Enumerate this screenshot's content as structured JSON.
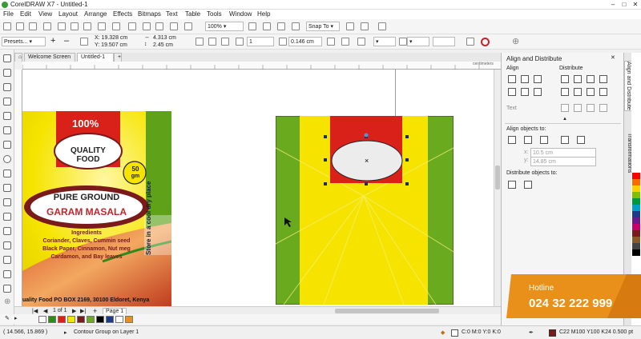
{
  "window": {
    "title": "CorelDRAW X7 - Untitled-1"
  },
  "menu": [
    "File",
    "Edit",
    "View",
    "Layout",
    "Arrange",
    "Effects",
    "Bitmaps",
    "Text",
    "Table",
    "Tools",
    "Window",
    "Help"
  ],
  "toolbar": {
    "zoom": "100%",
    "snap_label": "Snap To"
  },
  "propbar": {
    "presets": "Presets...",
    "x": "X: 19.328 cm",
    "y": "Y: 19.507 cm",
    "w": "4.313 cm",
    "h": "2.45 cm",
    "steps": "1",
    "offset": "0.146 cm"
  },
  "tabs": {
    "welcome": "Welcome Screen",
    "doc": "Untitled-1"
  },
  "ruler_unit": "centimeters",
  "pager": {
    "current": "1 of 1",
    "page": "Page 1"
  },
  "package": {
    "percent": "100%",
    "brand": "QUALITY FOOD",
    "weight_num": "50",
    "weight_unit": "gm",
    "side_text": "Store in a cool dry place",
    "product_line1": "PURE GROUND",
    "product_line2": "GARAM MASALA",
    "ingredients_title": "Ingredients",
    "ingredients_lines": [
      "Coriander, Claves, Cummin seed",
      "Black Paper, Cinnamon, Nut meg",
      "Cardamon, and Bay leaves"
    ],
    "address": "uality Food  PO BOX 2169, 30100 Eldoret, Kenya"
  },
  "docker": {
    "title": "Align and Distribute",
    "align": "Align",
    "distribute": "Distribute",
    "text": "Text",
    "align_to": "Align objects to:",
    "coord_x": "10.5 cm",
    "coord_y": "14.85 cm",
    "distribute_to": "Distribute objects to:"
  },
  "docker_tabs": [
    "Align and Distribute",
    "Transformations"
  ],
  "status": {
    "coords": "( 14.566, 15.869 )",
    "object": "Contour Group on Layer 1",
    "fill": "C:0 M:0 Y:0 K:0",
    "outline": "C22 M100 Y100 K24  0.500 pt"
  },
  "hotline": {
    "label": "Hotline",
    "number": "024 32 222 999"
  },
  "colors": {
    "accent": "#e8901a",
    "package_yellow": "#f6e400",
    "package_green": "#6aaa1e",
    "label_red": "#d9211a",
    "maroon": "#7a1a1a"
  }
}
